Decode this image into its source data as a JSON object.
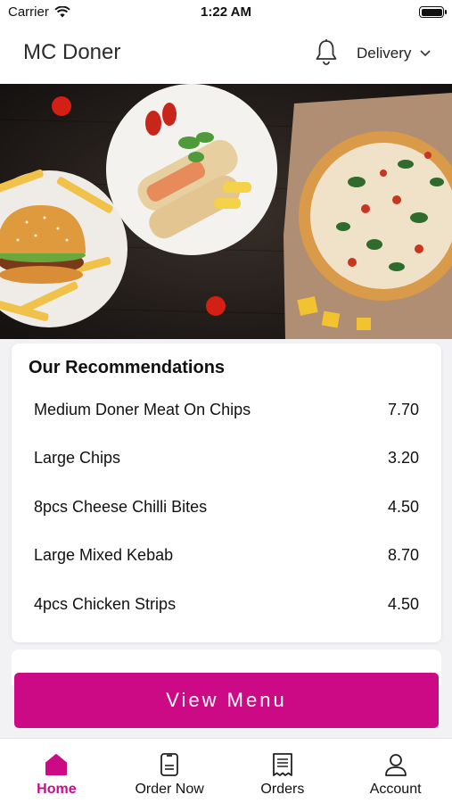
{
  "status_bar": {
    "carrier": "Carrier",
    "time": "1:22 AM"
  },
  "header": {
    "title": "MC Doner",
    "delivery_label": "Delivery"
  },
  "recommendations": {
    "title": "Our Recommendations",
    "items": [
      {
        "name": "Medium Doner Meat On Chips",
        "price": "7.70"
      },
      {
        "name": "Large Chips",
        "price": "3.20"
      },
      {
        "name": "8pcs Cheese Chilli Bites",
        "price": "4.50"
      },
      {
        "name": "Large Mixed Kebab",
        "price": "8.70"
      },
      {
        "name": "4pcs Chicken Strips",
        "price": "4.50"
      }
    ]
  },
  "view_menu_label": "View Menu",
  "tabs": [
    {
      "label": "Home",
      "icon": "home-icon",
      "active": true
    },
    {
      "label": "Order Now",
      "icon": "order-icon",
      "active": false
    },
    {
      "label": "Orders",
      "icon": "receipt-icon",
      "active": false
    },
    {
      "label": "Account",
      "icon": "account-icon",
      "active": false
    }
  ],
  "colors": {
    "accent": "#cc0a85",
    "background": "#f2f2f4"
  }
}
